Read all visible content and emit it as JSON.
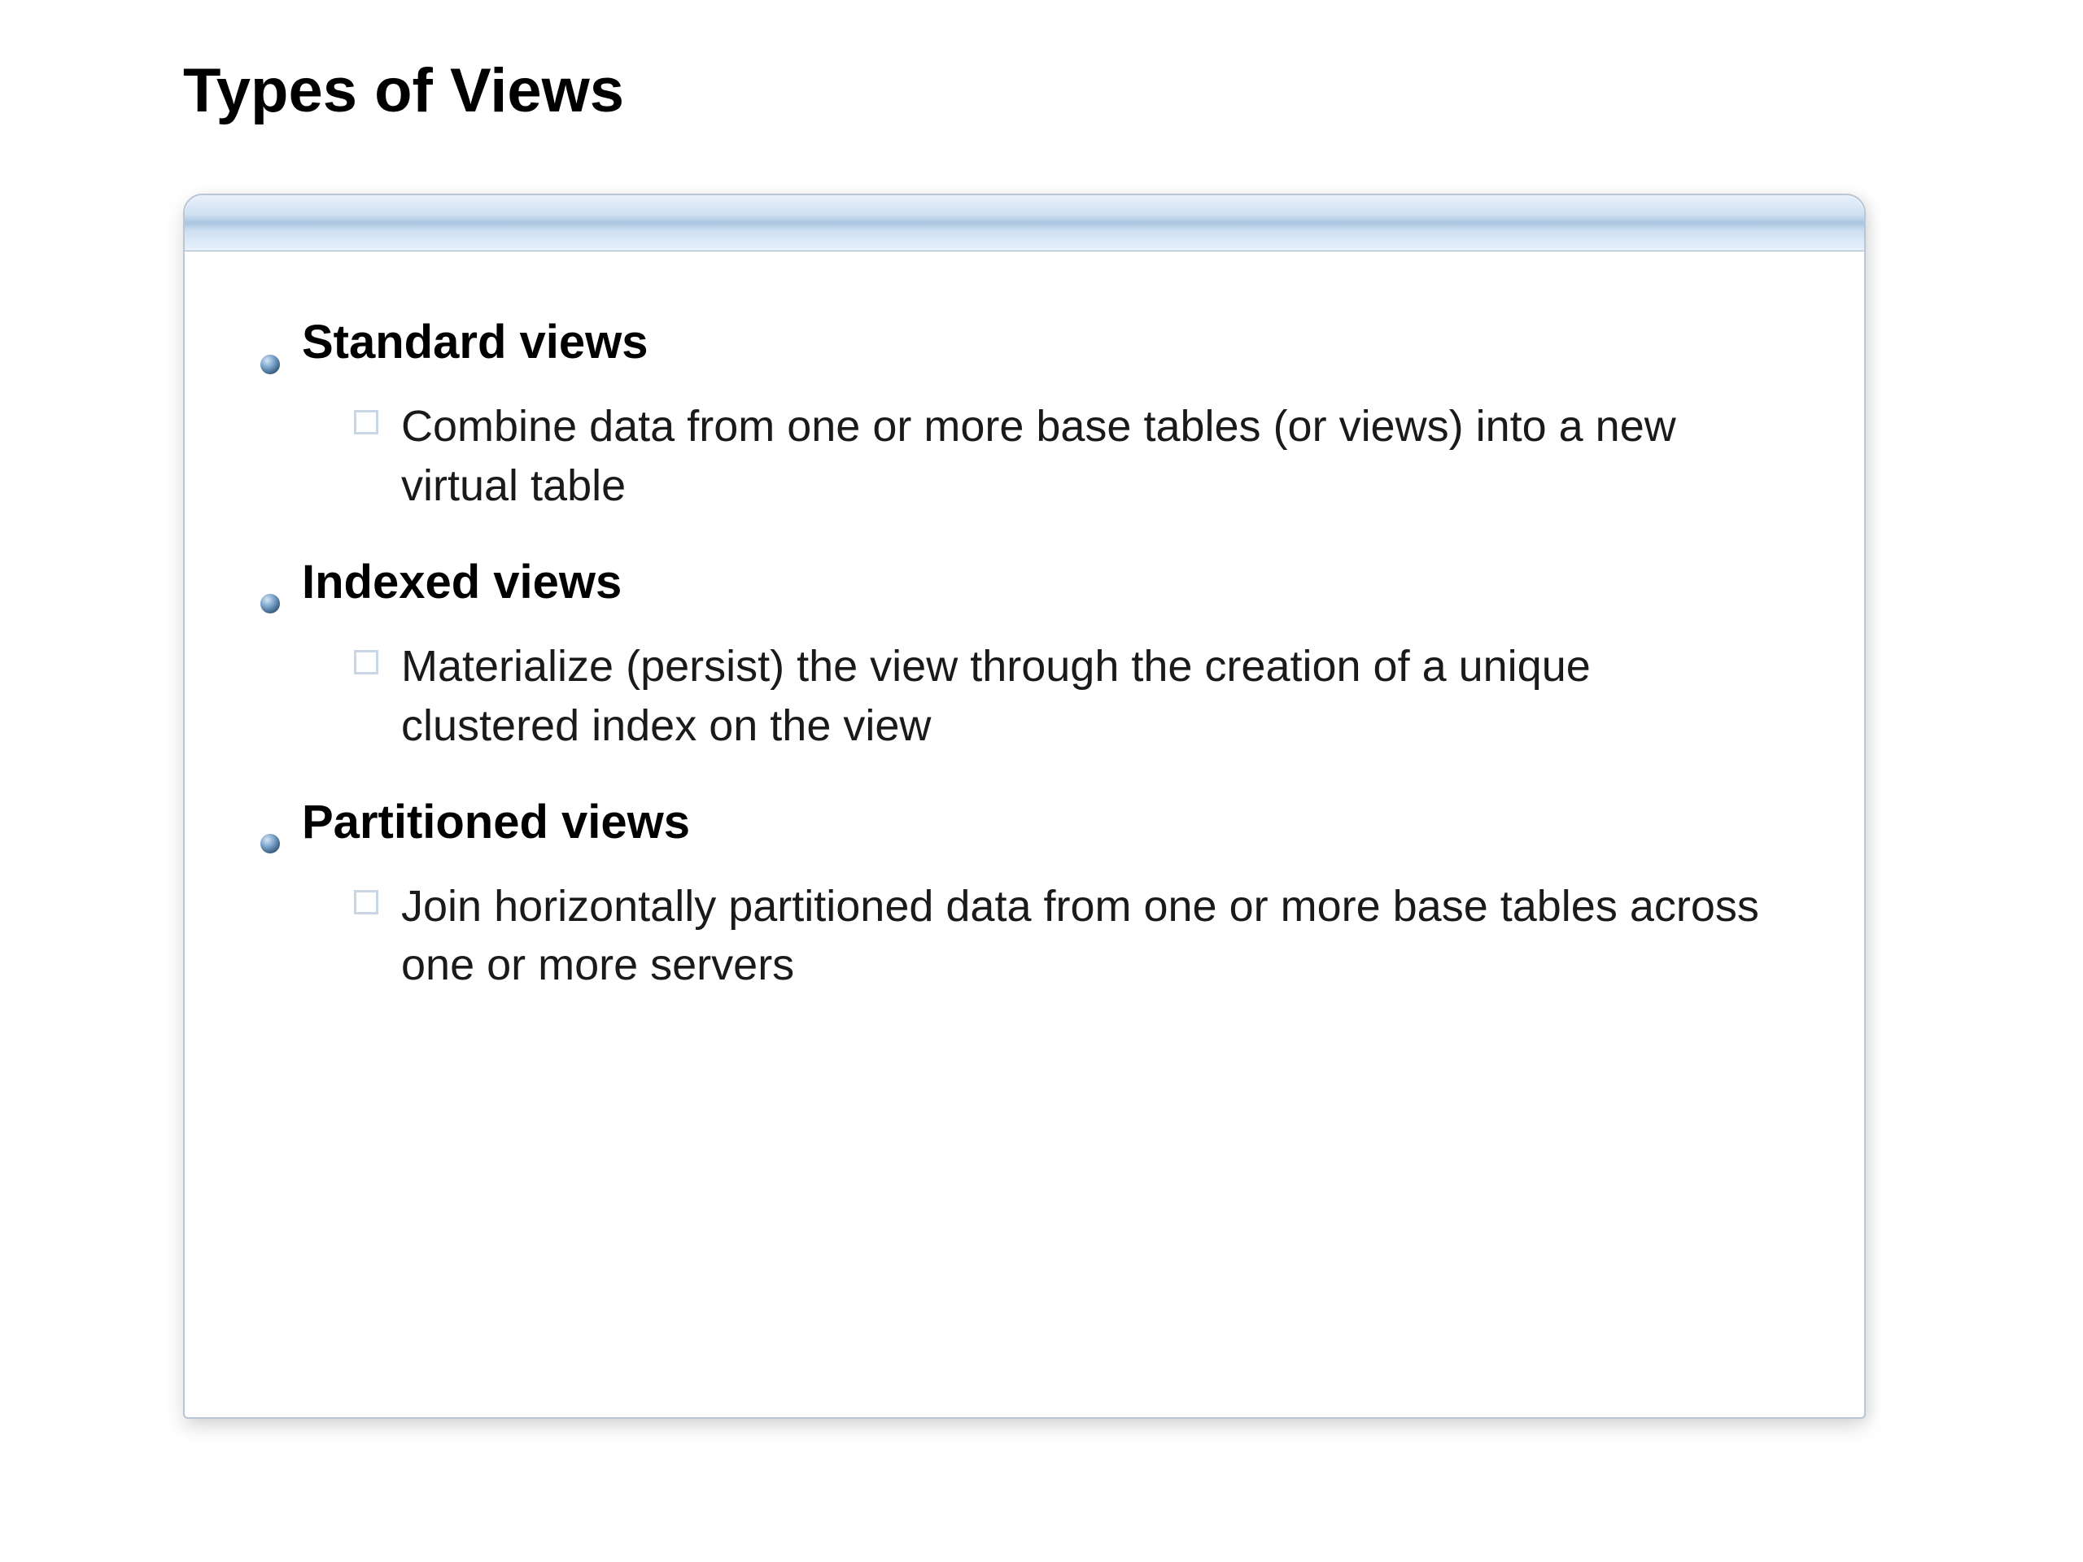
{
  "slide": {
    "title": "Types of Views",
    "items": [
      {
        "heading": "Standard views",
        "description": "Combine data from one or more base tables (or views) into a new virtual table"
      },
      {
        "heading": "Indexed views",
        "description": "Materialize (persist) the view through the creation of a unique clustered index on the view"
      },
      {
        "heading": "Partitioned views",
        "description": "Join horizontally partitioned data from one or more base tables across one or more servers"
      }
    ]
  },
  "colors": {
    "bullet_gradient_top": "#8fb6d8",
    "bullet_gradient_bottom": "#3d6a94",
    "header_bar": "#cfe0f2"
  }
}
